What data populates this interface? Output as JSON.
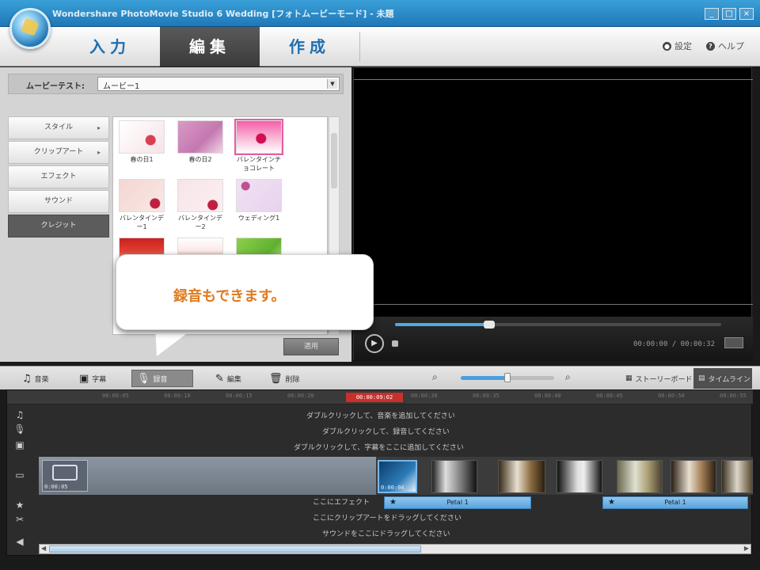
{
  "app": {
    "title": "Wondershare PhotoMovie Studio 6 Wedding [フォトムービーモード] - 未題",
    "window_controls": [
      "_",
      "□",
      "×"
    ]
  },
  "tabs": [
    {
      "label": "入力",
      "active": false
    },
    {
      "label": "編集",
      "active": true
    },
    {
      "label": "作成",
      "active": false
    }
  ],
  "top_links": {
    "settings": "設定",
    "help": "ヘルプ"
  },
  "left_panel": {
    "theme_label": "ムービーテスト:",
    "theme_value": "ムービー1",
    "categories": [
      {
        "label": "スタイル",
        "arrow": "▸",
        "active": false
      },
      {
        "label": "クリップアート",
        "arrow": "▸",
        "active": false
      },
      {
        "label": "エフェクト",
        "arrow": "",
        "active": false
      },
      {
        "label": "サウンド",
        "arrow": "",
        "active": false
      },
      {
        "label": "クレジット",
        "arrow": "",
        "active": true
      }
    ],
    "thumbnails": [
      {
        "label": "春の日1"
      },
      {
        "label": "春の日2"
      },
      {
        "label": "バレンタインチョコレート"
      },
      {
        "label": "バレンタインデー1"
      },
      {
        "label": "バレンタインデー2"
      },
      {
        "label": "ウェディング1"
      },
      {
        "label": ""
      },
      {
        "label": ""
      },
      {
        "label": ""
      }
    ],
    "apply_label": "適用"
  },
  "preview": {
    "timecode": "00:00:00 / 00:00:32",
    "seek_fraction": 0.29
  },
  "callout": {
    "text": "録音もできます。"
  },
  "timeline_toolbar": {
    "music": "音楽",
    "subtitle": "字幕",
    "record": "録音",
    "edit": "編集",
    "delete": "削除",
    "storyboard": "ストーリーボード",
    "timeline": "タイムライン",
    "zoom_fraction": 0.5
  },
  "timeline": {
    "ruler_ticks": [
      "00:00:05",
      "00:00:10",
      "00:00:15",
      "00:00:20",
      "00:00:25",
      "00:00:30",
      "00:00:35",
      "00:00:40",
      "00:00:45",
      "00:00:50",
      "00:00:55"
    ],
    "playhead": "00:00:09:02",
    "hints": {
      "music": "ダブルクリックして、音楽を追加してください",
      "record": "ダブルクリックして、録音してください",
      "subtitle": "ダブルクリックして、字幕をここに追加してください",
      "effect": "ここにエフェクト",
      "clipart": "ここにクリップアートをドラッグしてください",
      "sound": "サウンドをここにドラッグしてください"
    },
    "title_clip_label": "0:00:05",
    "first_clip_label": "0:00:04",
    "fx_label": "Petal 1",
    "fx_label2": "Petal 1"
  }
}
